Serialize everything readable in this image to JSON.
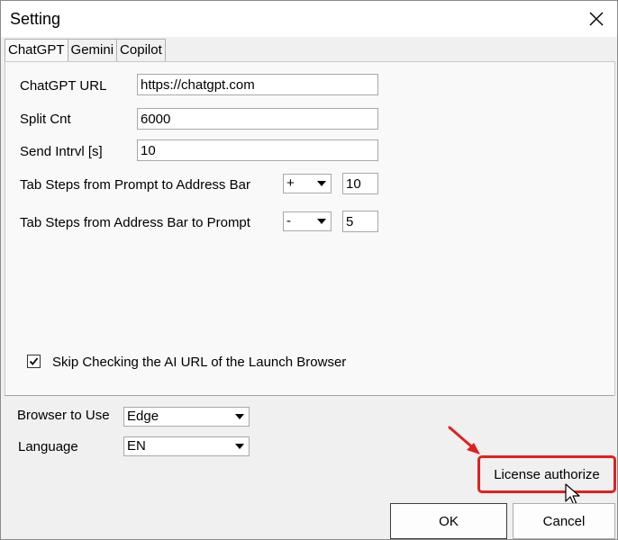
{
  "window": {
    "title": "Setting",
    "close_icon": "close-icon"
  },
  "tabs": [
    {
      "label": "ChatGPT",
      "active": true
    },
    {
      "label": "Gemini",
      "active": false
    },
    {
      "label": "Copilot",
      "active": false
    }
  ],
  "chatgpt": {
    "url_label": "ChatGPT URL",
    "url_value": "https://chatgpt.com",
    "split_label": "Split Cnt",
    "split_value": "6000",
    "interval_label": "Send Intrvl [s]",
    "interval_value": "10",
    "tab_to_address_label": "Tab Steps from Prompt to Address Bar",
    "tab_to_address_sign": "+",
    "tab_to_address_value": "10",
    "tab_to_prompt_label": "Tab Steps from Address Bar to Prompt",
    "tab_to_prompt_sign": "-",
    "tab_to_prompt_value": "5",
    "skip_check_label": "Skip Checking the AI URL of the Launch Browser",
    "skip_check_checked": true
  },
  "footer": {
    "browser_label": "Browser to Use",
    "browser_value": "Edge",
    "language_label": "Language",
    "language_value": "EN",
    "license_button": "License authorize",
    "ok_button": "OK",
    "cancel_button": "Cancel"
  },
  "colors": {
    "highlight": "#e02020",
    "window_bg": "#f0f0f0",
    "panel_bg": "#f9f9f9"
  }
}
